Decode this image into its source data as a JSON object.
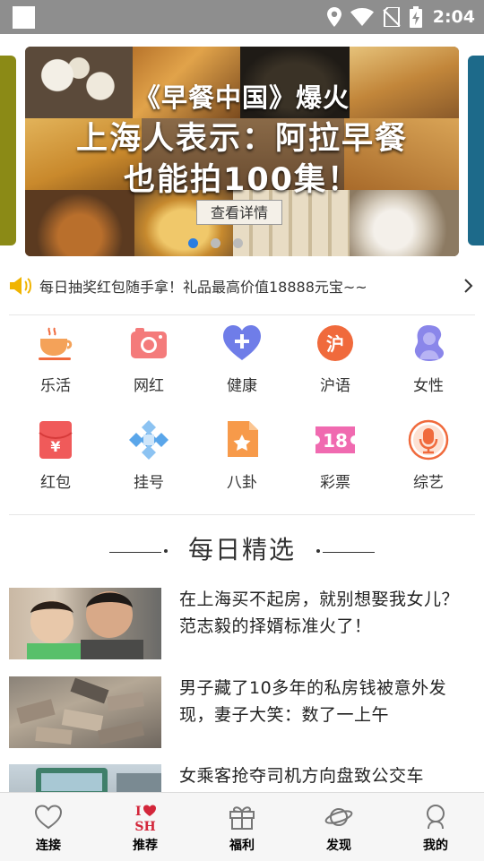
{
  "status_bar": {
    "time": "2:04",
    "icons": [
      "app-icon",
      "location-icon",
      "wifi-icon",
      "no-sim-icon",
      "battery-charging-icon"
    ]
  },
  "banner": {
    "headline": "《早餐中国》爆火",
    "line2": "上海人表示：阿拉早餐",
    "line3": "也能拍100集！",
    "button": "查看详情",
    "active_slide": 1,
    "slide_count": 3
  },
  "notice": {
    "text": "每日抽奖红包随手拿！礼品最高价值18888元宝~~"
  },
  "categories": [
    {
      "label": "乐活",
      "icon": "coffee-icon"
    },
    {
      "label": "网红",
      "icon": "camera-icon"
    },
    {
      "label": "健康",
      "icon": "health-heart-icon"
    },
    {
      "label": "沪语",
      "icon": "hu-badge-icon",
      "glyph": "沪"
    },
    {
      "label": "女性",
      "icon": "woman-icon"
    },
    {
      "label": "红包",
      "icon": "red-envelope-icon",
      "glyph": "¥"
    },
    {
      "label": "挂号",
      "icon": "medical-cross-icon"
    },
    {
      "label": "八卦",
      "icon": "gossip-star-icon"
    },
    {
      "label": "彩票",
      "icon": "lottery-18-icon",
      "glyph": "18"
    },
    {
      "label": "综艺",
      "icon": "microphone-icon"
    }
  ],
  "section": {
    "title": "每日精选"
  },
  "news": [
    {
      "title": "在上海买不起房，就别想娶我女儿？范志毅的择婿标准火了！"
    },
    {
      "title": "男子藏了10多年的私房钱被意外发现，妻子大笑：数了一上午"
    },
    {
      "title": "女乘客抢夺司机方向盘致公交车失控，法院判了：四",
      "title_visible": "女乘客抢夺司机方向盘致公交车"
    }
  ],
  "bottom_nav": [
    {
      "label": "连接",
      "icon": "heart-outline-icon"
    },
    {
      "label": "推荐",
      "icon": "i-love-sh-icon"
    },
    {
      "label": "福利",
      "icon": "gift-icon"
    },
    {
      "label": "发现",
      "icon": "planet-icon"
    },
    {
      "label": "我的",
      "icon": "profile-icon"
    }
  ],
  "colors": {
    "accent": "#f06a3c",
    "active_dot": "#2a7de1",
    "status_bar": "#8e8e8e"
  }
}
